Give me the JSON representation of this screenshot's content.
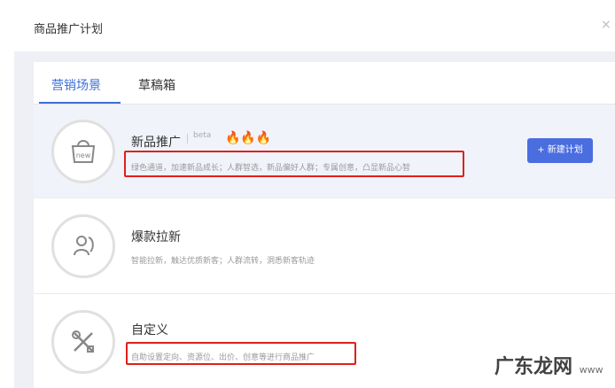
{
  "dialog": {
    "title": "商品推广计划",
    "close_glyph": "×"
  },
  "tabs": [
    {
      "label": "营销场景",
      "active": true
    },
    {
      "label": "草稿箱",
      "active": false
    }
  ],
  "cards": [
    {
      "title": "新品推广",
      "badge": "beta",
      "flames": "🔥🔥🔥",
      "desc": "绿色通道，加速新品成长；人群智选，新品偏好人群；专属创意，凸显新品心智",
      "icon": "new-bag-icon",
      "icon_text": "new",
      "button": "+ 新建计划"
    },
    {
      "title": "爆款拉新",
      "desc": "智能拉新，触达优质新客；人群流转，洞悉新客轨迹",
      "icon": "people-swap-icon"
    },
    {
      "title": "自定义",
      "desc": "自助设置定向、资源位、出价、创意等进行商品推广",
      "icon": "tools-icon"
    }
  ],
  "watermark": {
    "text": "广东龙网",
    "sub": "www"
  },
  "colors": {
    "accent": "#3d6fd6",
    "button": "#4a6ee0",
    "highlight_box": "#e0201a",
    "flame": "#e8401c"
  }
}
